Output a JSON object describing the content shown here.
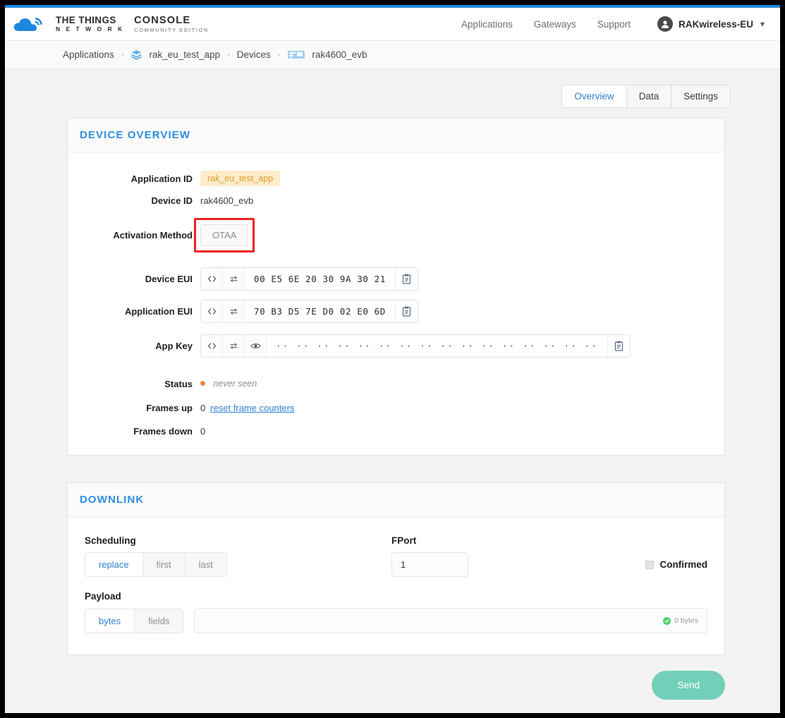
{
  "brand": {
    "logo_icon": "ttn-cloud-logo",
    "line1": "THE THINGS",
    "line2": "N E T W O R K",
    "console": "CONSOLE",
    "edition": "COMMUNITY EDITION"
  },
  "header": {
    "nav": [
      {
        "label": "Applications",
        "name": "nav-applications"
      },
      {
        "label": "Gateways",
        "name": "nav-gateways"
      },
      {
        "label": "Support",
        "name": "nav-support"
      }
    ],
    "user": {
      "name": "RAKwireless-EU",
      "chevron": "∨",
      "avatar_icon": "user-avatar-icon"
    }
  },
  "breadcrumb": [
    {
      "label": "Applications",
      "icon": null
    },
    {
      "label": "rak_eu_test_app",
      "icon": "layers-icon"
    },
    {
      "label": "Devices",
      "icon": null
    },
    {
      "label": "rak4600_evb",
      "icon": "device-board-icon"
    }
  ],
  "breadcrumb_separator": "›",
  "tabs": [
    {
      "label": "Overview",
      "active": true
    },
    {
      "label": "Data",
      "active": false
    },
    {
      "label": "Settings",
      "active": false
    }
  ],
  "device_overview": {
    "title": "DEVICE OVERVIEW",
    "application_id": {
      "label": "Application ID",
      "value": "rak_eu_test_app"
    },
    "device_id": {
      "label": "Device ID",
      "value": "rak4600_evb"
    },
    "activation_method": {
      "label": "Activation Method",
      "value": "OTAA",
      "highlighted": true
    },
    "device_eui": {
      "label": "Device EUI",
      "value": "00 E5 6E 20 30 9A 30 21"
    },
    "application_eui": {
      "label": "Application EUI",
      "value": "70 B3 D5 7E D0 02 E0 6D"
    },
    "app_key": {
      "label": "App Key",
      "value": "·· ·· ·· ·· ·· ·· ·· ·· ·· ·· ·· ·· ·· ·· ·· ··"
    },
    "status": {
      "label": "Status",
      "value": "never seen",
      "dot_color": "#f0853e"
    },
    "frames_up": {
      "label": "Frames up",
      "value": "0",
      "link": "reset frame counters"
    },
    "frames_down": {
      "label": "Frames down",
      "value": "0"
    },
    "icons": {
      "code": "‹›",
      "swap": "swap-icon",
      "eye": "eye-icon",
      "copy": "clipboard-icon"
    }
  },
  "downlink": {
    "title": "DOWNLINK",
    "scheduling": {
      "label": "Scheduling",
      "options": [
        {
          "label": "replace",
          "active": true
        },
        {
          "label": "first",
          "active": false
        },
        {
          "label": "last",
          "active": false
        }
      ]
    },
    "fport": {
      "label": "FPort",
      "value": "1"
    },
    "confirmed": {
      "label": "Confirmed",
      "checked": false
    },
    "payload": {
      "label": "Payload",
      "options": [
        {
          "label": "bytes",
          "active": true
        },
        {
          "label": "fields",
          "active": false
        }
      ],
      "value": "",
      "byte_count": "0 bytes"
    },
    "send_button": "Send"
  },
  "colors": {
    "accent_blue": "#2f8ee0",
    "top_strip": "#1e87dd",
    "badge_bg": "#fdecc8",
    "badge_text": "#e09b2d",
    "highlight_red": "#ee2222",
    "send_teal": "#73cfb8",
    "status_orange": "#f0853e",
    "check_green": "#4cd276"
  }
}
